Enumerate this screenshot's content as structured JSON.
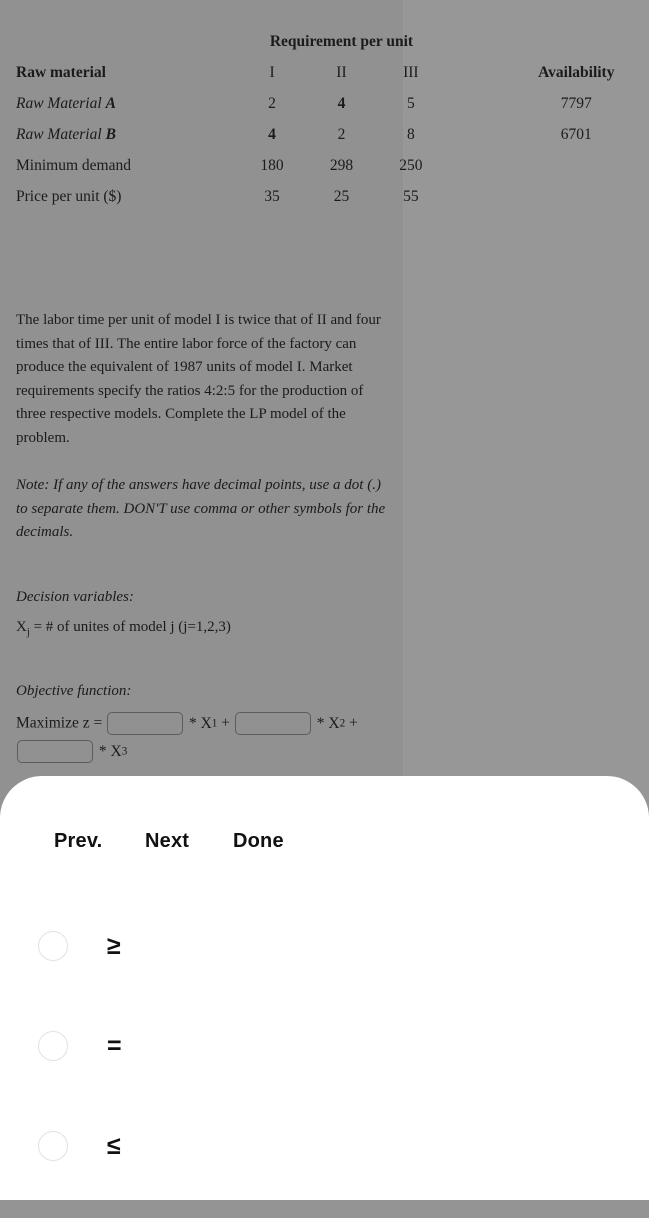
{
  "background": {
    "left_pane_color": "#919191",
    "right_pane_color": "#979797",
    "sheet_color": "#ffffff"
  },
  "table": {
    "span_header": "Requirement per unit",
    "row_header_label": "Raw material",
    "columns": [
      "I",
      "II",
      "III"
    ],
    "availability_header": "Availability",
    "rows": [
      {
        "label": "Raw Material A",
        "label_plain": "Raw Material ",
        "label_bold": "A",
        "values": [
          "2",
          "4",
          "5"
        ],
        "availability": "7797"
      },
      {
        "label": "Raw Material B",
        "label_plain": "Raw Material ",
        "label_bold": "B",
        "values": [
          "4",
          "2",
          "8"
        ],
        "availability": "6701"
      },
      {
        "label": "Minimum demand",
        "values": [
          "180",
          "298",
          "250"
        ],
        "availability": ""
      },
      {
        "label": "Price per unit ($)",
        "values": [
          "35",
          "25",
          "55"
        ],
        "availability": ""
      }
    ]
  },
  "question": {
    "paragraph": "The labor time per unit of model I is twice that of II and four times that of III. The entire labor force of the factory can produce the equivalent of 1987 units of model I. Market requirements specify the ratios 4:2:5 for the production of three respective models. Complete the LP model of the problem.",
    "note": "Note: If any of the answers have decimal points, use a dot (.) to separate them. DON'T use comma or other symbols for the decimals.",
    "decision_variables_label": "Decision variables:",
    "decision_variables_text": "Xj = # of unites of model j (j=1,2,3)",
    "decision_var_symbol": "X",
    "decision_var_subscript": "j",
    "decision_var_rest": " = # of unites of model j (j=1,2,3)",
    "objective_function_label": "Objective function:",
    "maximize_prefix": "Maximize z =",
    "term1_suffix": "* X",
    "term1_sub": "1",
    "plus1": "+",
    "term2_suffix": "* X",
    "term2_sub": "2",
    "plus2": "+",
    "term3_suffix": "* X",
    "term3_sub": "3"
  },
  "inputs": {
    "coef1_value": "",
    "coef2_value": "",
    "coef3_value": "",
    "placeholder": ""
  },
  "sheet": {
    "nav": {
      "prev_label": "Prev.",
      "next_label": "Next",
      "done_label": "Done"
    },
    "options": [
      {
        "symbol": "≥",
        "selected": false
      },
      {
        "symbol": "=",
        "selected": false
      },
      {
        "symbol": "≤",
        "selected": false
      }
    ]
  }
}
